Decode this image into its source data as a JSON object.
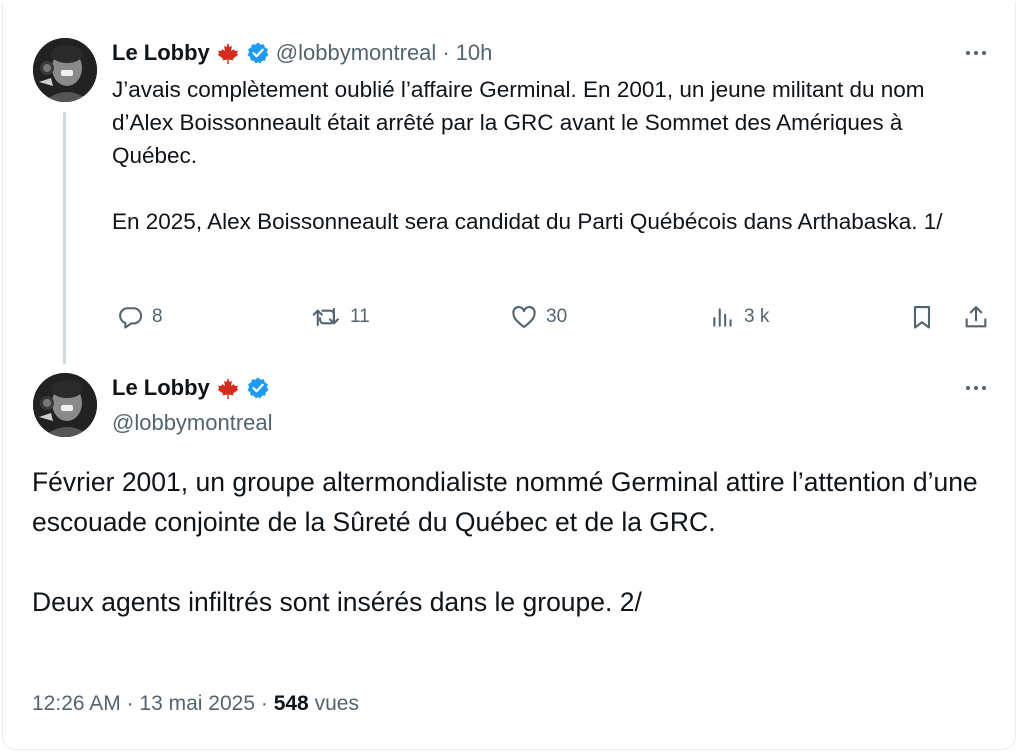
{
  "tweet1": {
    "display_name": "Le Lobby",
    "handle": "@lobbymontreal",
    "separator": "·",
    "time": "10h",
    "paragraphs": [
      "J’avais complètement oublié l’affaire Germinal. En 2001, un jeune militant du nom d’Alex Boissonneault était arrêté par la GRC avant le Sommet des Amériques à Québec.",
      "En 2025, Alex Boissonneault sera candidat du Parti Québécois dans Arthabaska. 1/"
    ],
    "actions": {
      "replies": "8",
      "reposts": "11",
      "likes": "30",
      "views": "3 k"
    }
  },
  "tweet2": {
    "display_name": "Le Lobby",
    "handle": "@lobbymontreal",
    "paragraphs": [
      "Février 2001, un groupe altermondialiste nommé Germinal attire l’attention d’une escouade conjointe de la Sûreté du Québec et de la GRC.",
      "Deux agents infiltrés sont insérés dans le groupe. 2/"
    ],
    "timestamp": "12:26 AM",
    "separator1": "·",
    "date": "13 mai 2025",
    "separator2": "·",
    "views_count": "548",
    "views_label": "vues"
  },
  "icons": {
    "flag": "maple-leaf-icon",
    "verified": "verified-badge-icon",
    "more": "more-icon",
    "reply": "reply-icon",
    "repost": "repost-icon",
    "like": "heart-icon",
    "views": "views-icon",
    "bookmark": "bookmark-icon",
    "share": "share-icon"
  },
  "colors": {
    "flag": "#d52b1e",
    "verified": "#1d9bf0",
    "muted": "#536471",
    "text": "#0f1419",
    "thread_line": "#cfd9de"
  }
}
